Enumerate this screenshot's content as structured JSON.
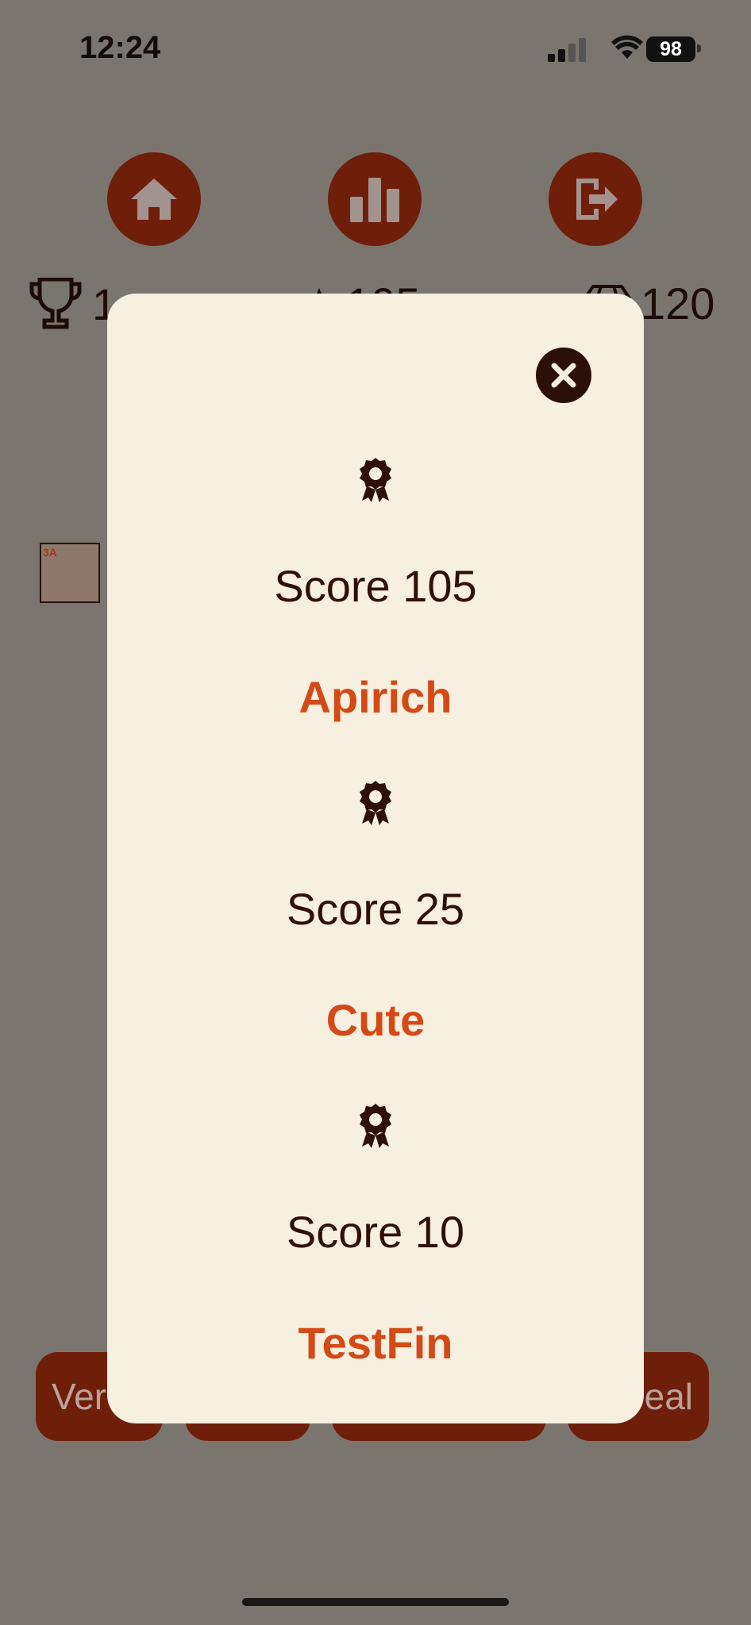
{
  "status_bar": {
    "time": "12:24",
    "battery": "98"
  },
  "nav": {
    "home_icon": "home-icon",
    "stats_icon": "bar-chart-icon",
    "exit_icon": "logout-icon"
  },
  "stats": {
    "trophies": "1",
    "stars": "105",
    "gems": "120"
  },
  "tile": {
    "label": "3A"
  },
  "bottom_buttons": {
    "left_label": "Ver",
    "right_label": "eal"
  },
  "modal": {
    "close_icon": "close-icon",
    "entries": [
      {
        "score": "Score 105",
        "name": "Apirich"
      },
      {
        "score": "Score 25",
        "name": "Cute"
      },
      {
        "score": "Score 10",
        "name": "TestFin"
      }
    ]
  },
  "colors": {
    "accent": "#6f1e0a",
    "name": "#d44a16",
    "modal_bg": "#f7efe0",
    "overlay": "#7a766f"
  }
}
